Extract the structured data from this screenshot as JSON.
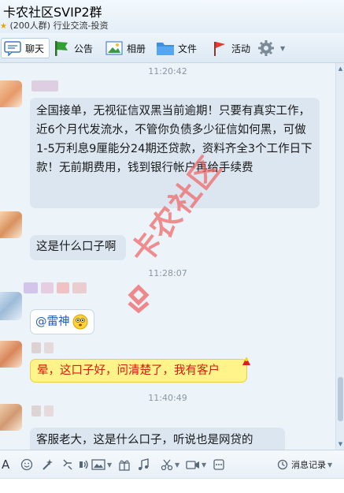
{
  "window": {
    "title": "卡农社区SVIP2群",
    "member_count": "(200人群)",
    "category": "行业交流-投资"
  },
  "toolbar": {
    "chat_label": "聊天",
    "announcement_label": "公告",
    "album_label": "相册",
    "files_label": "文件",
    "activity_label": "活动"
  },
  "messages": [
    {
      "time": "11:20:42"
    },
    {
      "text": "全国接单，无视征信双黑当前逾期！只要有真实工作，近6个月代发流水，不管你负债多少征信如何黑，可做1-5万利息9厘能分24期还贷款，资料齐全3个工作日下款！无前期费用，钱到银行帐户再给手续费"
    },
    {
      "text": "这是什么口子啊"
    },
    {
      "time": "11:28:07"
    },
    {
      "mention": "@雷神"
    },
    {
      "text": "晕，这口子好，问清楚了，我有客户"
    },
    {
      "time": "11:40:49"
    },
    {
      "text": "客服老大，这是什么口子，听说也是网贷的"
    }
  ],
  "watermark": {
    "text": "卡农社区"
  },
  "input_toolbar": {
    "history_label": "消息记录"
  },
  "colors": {
    "accent": "#2f73c0",
    "bubble": "#dbe6f0",
    "yellow_bubble": "#fff48a",
    "yellow_text": "#d61a0e",
    "watermark": "#f06464"
  }
}
